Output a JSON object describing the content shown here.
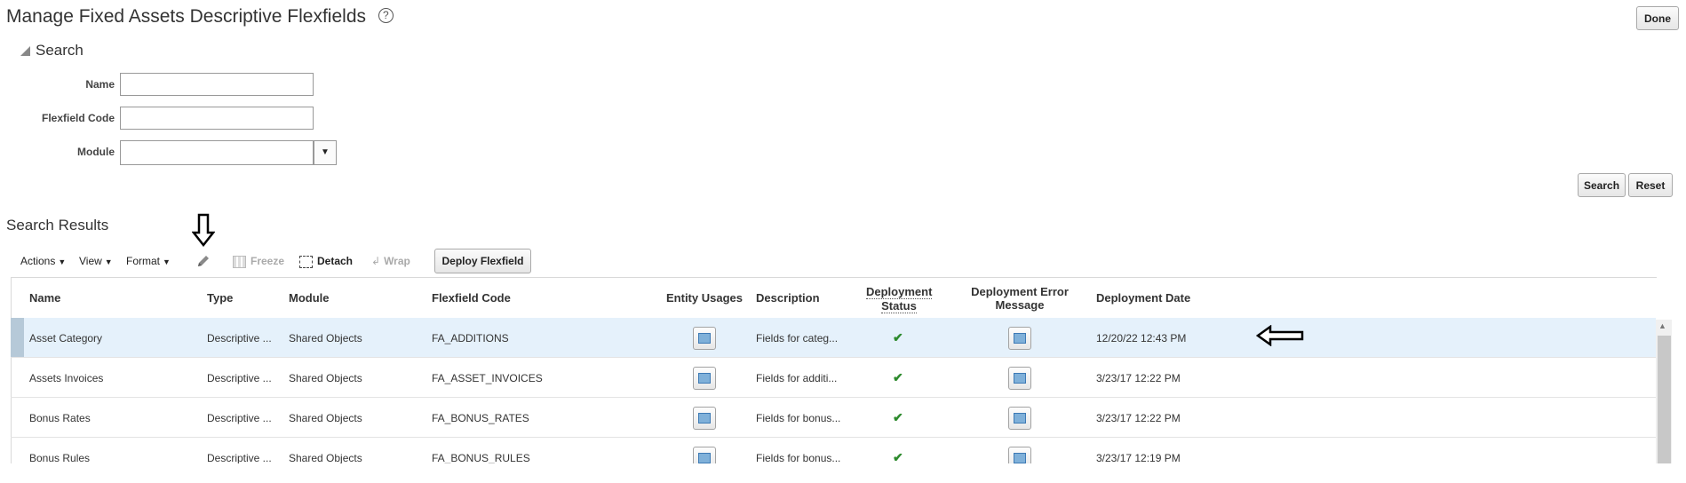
{
  "page": {
    "title": "Manage Fixed Assets Descriptive Flexfields",
    "help_icon": "?",
    "done_label": "Done"
  },
  "search": {
    "header": "Search",
    "fields": {
      "name_label": "Name",
      "name_value": "",
      "code_label": "Flexfield Code",
      "code_value": "",
      "module_label": "Module",
      "module_value": ""
    },
    "search_button": "Search",
    "reset_button": "Reset"
  },
  "results": {
    "header": "Search Results",
    "toolbar": {
      "actions": "Actions",
      "view": "View",
      "format": "Format",
      "freeze": "Freeze",
      "detach": "Detach",
      "wrap": "Wrap",
      "deploy": "Deploy Flexfield"
    },
    "columns": {
      "name": "Name",
      "type": "Type",
      "module": "Module",
      "code": "Flexfield Code",
      "entity": "Entity Usages",
      "description": "Description",
      "status_1": "Deployment",
      "status_2": "Status",
      "error_1": "Deployment Error",
      "error_2": "Message",
      "date": "Deployment Date"
    },
    "rows": [
      {
        "name": "Asset Category",
        "type": "Descriptive ...",
        "module": "Shared Objects",
        "code": "FA_ADDITIONS",
        "description": "Fields for categ...",
        "date": "12/20/22 12:43 PM"
      },
      {
        "name": "Assets Invoices",
        "type": "Descriptive ...",
        "module": "Shared Objects",
        "code": "FA_ASSET_INVOICES",
        "description": "Fields for additi...",
        "date": "3/23/17 12:22 PM"
      },
      {
        "name": "Bonus Rates",
        "type": "Descriptive ...",
        "module": "Shared Objects",
        "code": "FA_BONUS_RATES",
        "description": "Fields for bonus...",
        "date": "3/23/17 12:22 PM"
      },
      {
        "name": "Bonus Rules",
        "type": "Descriptive ...",
        "module": "Shared Objects",
        "code": "FA_BONUS_RULES",
        "description": "Fields for bonus...",
        "date": "3/23/17 12:19 PM"
      }
    ]
  },
  "icons": {
    "edit": "pencil-icon",
    "freeze": "freeze-icon",
    "detach": "detach-icon",
    "wrap": "wrap-icon",
    "entity": "entity-usages-icon",
    "error": "error-message-icon",
    "status": "checkmark-icon",
    "annotation_down": "arrow-down-annotation",
    "annotation_left": "arrow-left-annotation"
  },
  "colors": {
    "selected_row": "#e5f1fb",
    "status_ok": "#2d8a2d"
  }
}
